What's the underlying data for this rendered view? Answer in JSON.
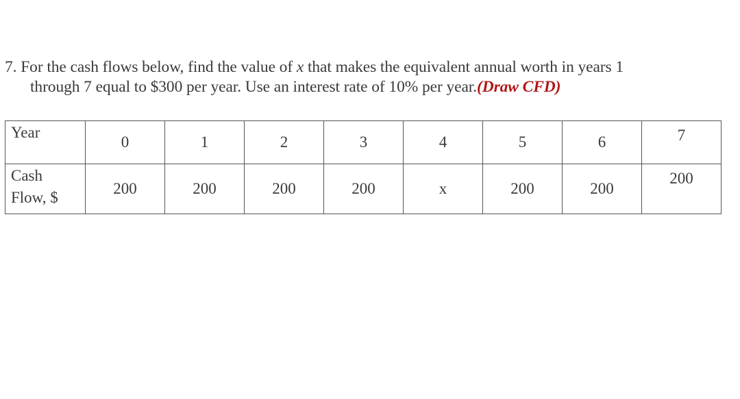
{
  "question": {
    "number": "7.",
    "part1": " For the cash flows below, find the value of ",
    "variable": "x",
    "part2": " that makes the equivalent annual worth in years 1",
    "line2": "through 7 equal to $300 per year. Use an interest rate of 10% per year.",
    "highlight": "(Draw CFD)",
    "highlight_color": "#b01818"
  },
  "table": {
    "row_labels": {
      "year": "Year",
      "cash_line1": "Cash",
      "cash_line2": "Flow, $"
    },
    "years": [
      "0",
      "1",
      "2",
      "3",
      "4",
      "5",
      "6",
      "7"
    ],
    "cash_flows": [
      "200",
      "200",
      "200",
      "200",
      "x",
      "200",
      "200",
      "200"
    ]
  }
}
